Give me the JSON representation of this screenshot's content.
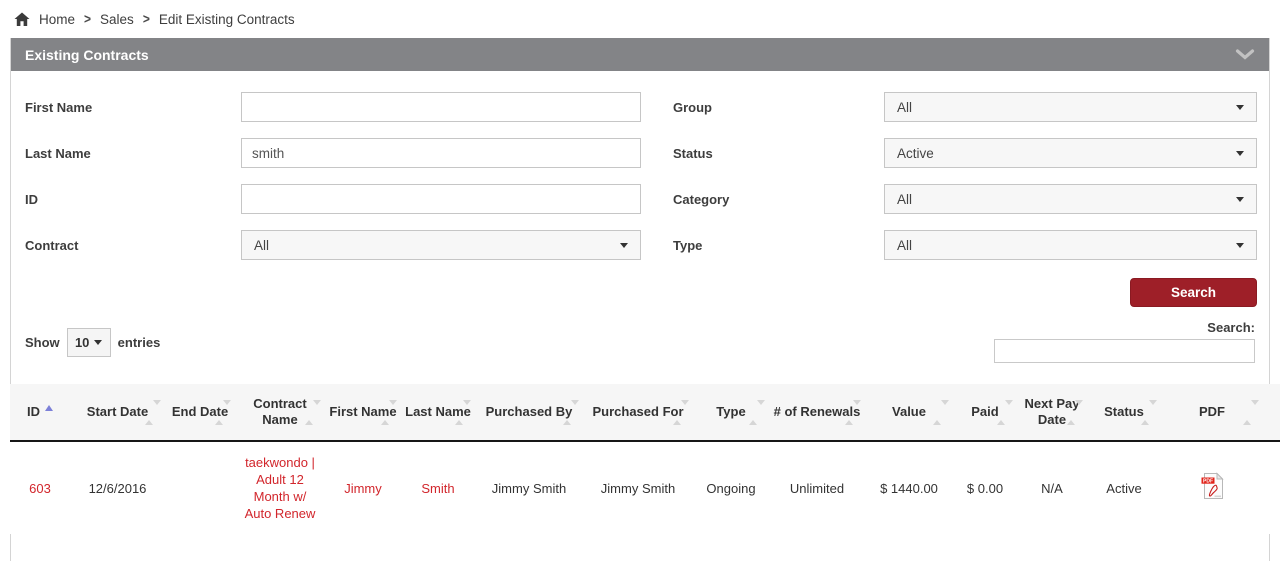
{
  "breadcrumb": {
    "separator": ">",
    "items": [
      "Home",
      "Sales",
      "Edit Existing Contracts"
    ]
  },
  "panel": {
    "title": "Existing Contracts"
  },
  "filters": {
    "left": [
      {
        "label": "First Name",
        "type": "input",
        "value": ""
      },
      {
        "label": "Last Name",
        "type": "input",
        "value": "smith"
      },
      {
        "label": "ID",
        "type": "input",
        "value": ""
      },
      {
        "label": "Contract",
        "type": "select",
        "value": "All"
      }
    ],
    "right": [
      {
        "label": "Group",
        "type": "select",
        "value": "All"
      },
      {
        "label": "Status",
        "type": "select",
        "value": "Active"
      },
      {
        "label": "Category",
        "type": "select",
        "value": "All"
      },
      {
        "label": "Type",
        "type": "select",
        "value": "All"
      }
    ],
    "search_button": "Search"
  },
  "controls": {
    "show": "Show",
    "page_size": "10",
    "entries": "entries",
    "search_label": "Search:",
    "search_value": ""
  },
  "table": {
    "columns": [
      "ID",
      "Start Date",
      "End Date",
      "Contract Name",
      "First Name",
      "Last Name",
      "Purchased By",
      "Purchased For",
      "Type",
      "# of Renewals",
      "Value",
      "Paid",
      "Next Pay Date",
      "Status",
      "PDF"
    ],
    "sorted_column": "ID",
    "sort_direction": "asc",
    "pdf_icon_label": "PDF",
    "rows": [
      {
        "id": "603",
        "start_date": "12/6/2016",
        "end_date": "",
        "contract_name": "taekwondo | Adult 12 Month w/ Auto Renew",
        "first_name": "Jimmy",
        "last_name": "Smith",
        "purchased_by": "Jimmy Smith",
        "purchased_for": "Jimmy Smith",
        "type": "Ongoing",
        "renewals": "Unlimited",
        "value": "$ 1440.00",
        "paid": "$ 0.00",
        "next_pay_date": "N/A",
        "status": "Active",
        "pdf": "pdf-icon"
      }
    ]
  },
  "colors": {
    "panel_header_gray": "#838487",
    "button_red": "#9e1f28",
    "link_red": "#d2262c",
    "sort_active_blue": "#7c80d8"
  }
}
